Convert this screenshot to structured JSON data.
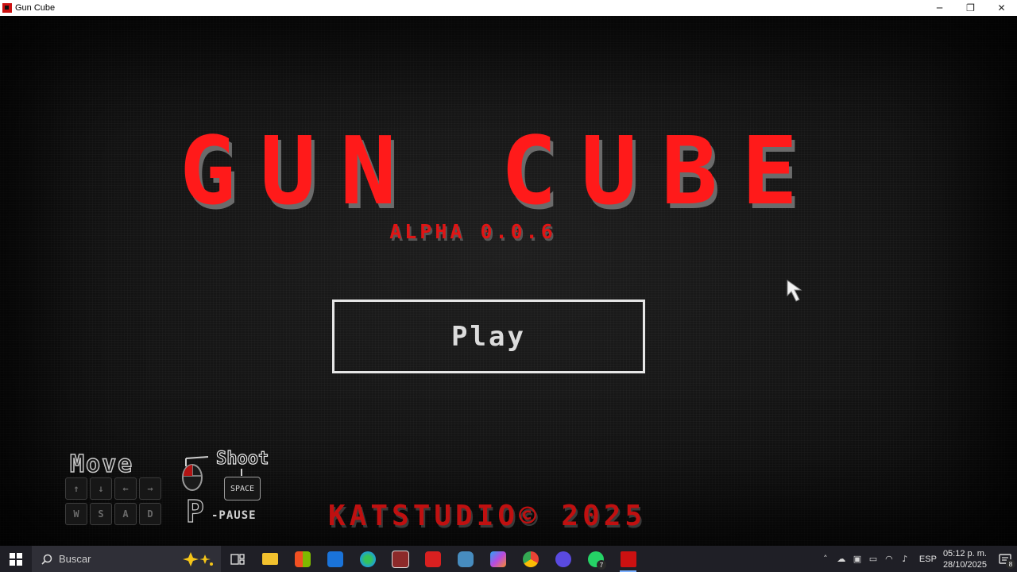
{
  "window": {
    "title": "Gun Cube",
    "controls": {
      "minimize": "─",
      "restore": "❐",
      "close": "✕"
    }
  },
  "game": {
    "title": "GUN CUBE",
    "version": "ALPHA 0.0.6",
    "play_label": "Play",
    "controls_hint": {
      "move_label": "Move",
      "arrow_keys": [
        "↑",
        "↓",
        "←",
        "→"
      ],
      "letter_keys": [
        "W",
        "S",
        "A",
        "D"
      ],
      "shoot_label": "Shoot",
      "space_key": "SPACE",
      "pause_key": "P",
      "pause_label": "-PAUSE"
    },
    "credit": "KATSTUDIO© 2025",
    "colors": {
      "title": "#ff1a1a",
      "credit": "#c01010",
      "button_border": "#e6e6e6"
    }
  },
  "taskbar": {
    "search_placeholder": "Buscar",
    "apps": [
      {
        "name": "task-view",
        "color": "#3a3a44"
      },
      {
        "name": "file-explorer",
        "color": "#f2c12e"
      },
      {
        "name": "microsoft-store",
        "color": "#2a7de1"
      },
      {
        "name": "outlook",
        "color": "#1a73d9"
      },
      {
        "name": "edge",
        "color": "#1ea1d8"
      },
      {
        "name": "game-app",
        "color": "#8c2a2a"
      },
      {
        "name": "wps-office",
        "color": "#d92020"
      },
      {
        "name": "godot",
        "color": "#478cbf"
      },
      {
        "name": "copilot",
        "color": "#b84be0"
      },
      {
        "name": "chrome",
        "color": "#e8c23a"
      },
      {
        "name": "browser",
        "color": "#5a4ae0"
      },
      {
        "name": "whatsapp",
        "color": "#25d366",
        "badge": "7"
      },
      {
        "name": "gun-cube",
        "color": "#cc1111",
        "active": true
      }
    ],
    "tray": {
      "language": "ESP",
      "time": "05:12 p. m.",
      "date": "28/10/2025",
      "notification_count": "8"
    }
  }
}
